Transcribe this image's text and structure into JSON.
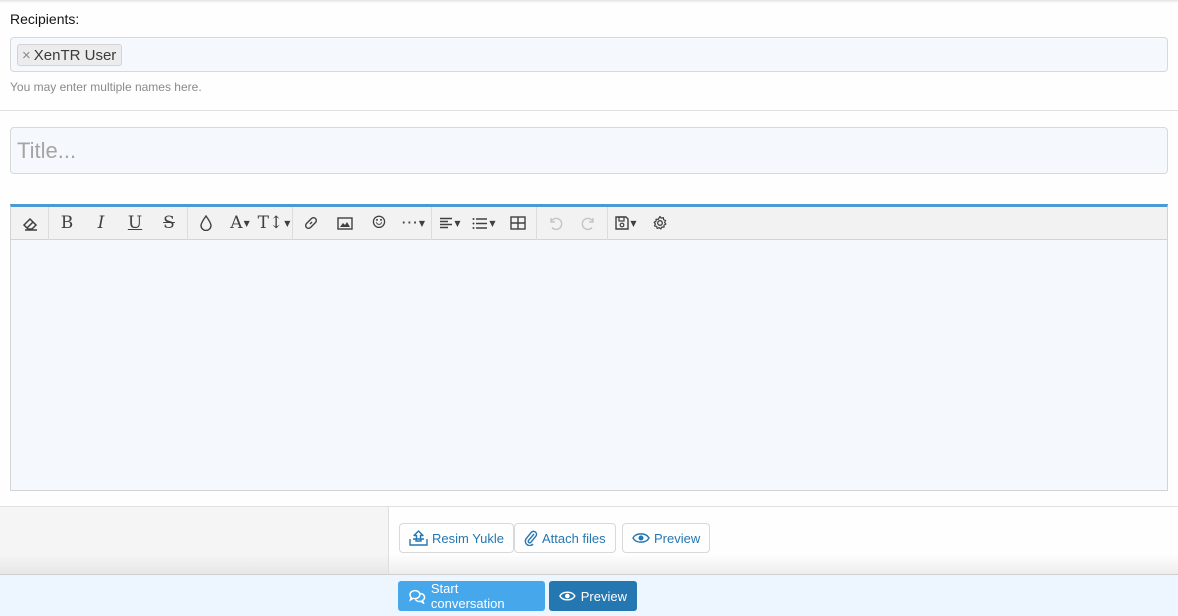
{
  "recipients": {
    "label": "Recipients:",
    "tokens": [
      {
        "name": "XenTR User",
        "remove_glyph": "×"
      }
    ],
    "hint": "You may enter multiple names here."
  },
  "title_field": {
    "placeholder": "Title...",
    "value": ""
  },
  "editor": {
    "accent_color": "#4a9bd5",
    "toolbar": [
      {
        "icon": "eraser-icon",
        "title": "Remove formatting"
      },
      {
        "icon": "bold-icon",
        "glyph": "B"
      },
      {
        "icon": "italic-icon",
        "glyph": "I"
      },
      {
        "icon": "underline-icon",
        "glyph": "U"
      },
      {
        "icon": "strikethrough-icon",
        "glyph": "S"
      },
      {
        "icon": "text-color-icon"
      },
      {
        "icon": "font-family-icon",
        "glyph": "A"
      },
      {
        "icon": "font-size-icon",
        "glyph": "T↕"
      },
      {
        "icon": "link-icon"
      },
      {
        "icon": "image-icon"
      },
      {
        "icon": "emoji-icon",
        "glyph": "☺"
      },
      {
        "icon": "more-icon",
        "glyph": "⋯"
      },
      {
        "icon": "align-icon"
      },
      {
        "icon": "list-icon"
      },
      {
        "icon": "table-icon"
      },
      {
        "icon": "undo-icon",
        "disabled": true
      },
      {
        "icon": "redo-icon",
        "disabled": true
      },
      {
        "icon": "drafts-icon"
      },
      {
        "icon": "settings-icon"
      }
    ]
  },
  "attachments": {
    "upload_image_label": "Resim Yukle",
    "attach_files_label": "Attach files",
    "preview_label": "Preview"
  },
  "submit": {
    "start_label": "Start conversation",
    "start_color": "#47a7eb",
    "preview_label": "Preview",
    "preview_color": "#2577b1"
  }
}
